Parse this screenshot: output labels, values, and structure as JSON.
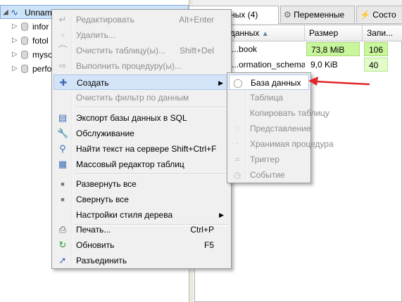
{
  "tree": {
    "root_label": "Unnamed",
    "items": [
      "infor",
      "fotol",
      "mysc",
      "perfo"
    ]
  },
  "tabs": {
    "databases": "Базы данных (4)",
    "variables": "Переменные",
    "status": "Состо"
  },
  "grid": {
    "headers": [
      "Базы данных",
      "Размер",
      "Запи..."
    ],
    "rows": [
      {
        "name": "...book",
        "size": "73,8 MiB",
        "items": "106"
      },
      {
        "name": "...ormation_schema",
        "size": "9,0 KiB",
        "items": "40"
      }
    ]
  },
  "context_menu": {
    "items": [
      {
        "label": "Редактировать",
        "shortcut": "Alt+Enter",
        "icon": "edit-icon"
      },
      {
        "label": "Удалить...",
        "shortcut": "",
        "icon": "delete-icon"
      },
      {
        "label": "Очистить таблицу(ы)...",
        "shortcut": "Shift+Del",
        "icon": "clear-icon"
      },
      {
        "label": "Выполнить процедуру(ы)...",
        "shortcut": "",
        "icon": "run-icon"
      },
      {
        "label": "Создать",
        "shortcut": "",
        "icon": "create-icon"
      },
      {
        "label": "Очистить фильтр по данным",
        "shortcut": "",
        "icon": ""
      },
      {
        "label": "Экспорт базы данных в SQL",
        "shortcut": "",
        "icon": "export-icon"
      },
      {
        "label": "Обслуживание",
        "shortcut": "",
        "icon": "wrench-icon"
      },
      {
        "label": "Найти текст на сервере",
        "shortcut": "Shift+Ctrl+F",
        "icon": "search-icon"
      },
      {
        "label": "Массовый редактор таблиц",
        "shortcut": "",
        "icon": "table-icon"
      },
      {
        "label": "Развернуть все",
        "shortcut": "",
        "icon": "expand-icon"
      },
      {
        "label": "Свернуть все",
        "shortcut": "",
        "icon": "collapse-icon"
      },
      {
        "label": "Настройки стиля дерева",
        "shortcut": "",
        "icon": ""
      },
      {
        "label": "Печать...",
        "shortcut": "Ctrl+P",
        "icon": "print-icon"
      },
      {
        "label": "Обновить",
        "shortcut": "F5",
        "icon": "refresh-icon"
      },
      {
        "label": "Разъединить",
        "shortcut": "",
        "icon": "disconnect-icon"
      }
    ]
  },
  "submenu": {
    "items": [
      {
        "label": "База данных",
        "icon": "database-icon"
      },
      {
        "label": "Таблица",
        "icon": ""
      },
      {
        "label": "Копировать таблицу",
        "icon": ""
      },
      {
        "label": "Представление",
        "icon": "view-icon"
      },
      {
        "label": "Хранимая процедура",
        "icon": "procedure-icon"
      },
      {
        "label": "Триггер",
        "icon": "trigger-icon"
      },
      {
        "label": "Событие",
        "icon": "event-icon"
      }
    ]
  },
  "colors": {
    "highlight_bg": "#d4e4f8",
    "bar_green": "#c9f59d",
    "annotation_red": "#e0262b"
  }
}
